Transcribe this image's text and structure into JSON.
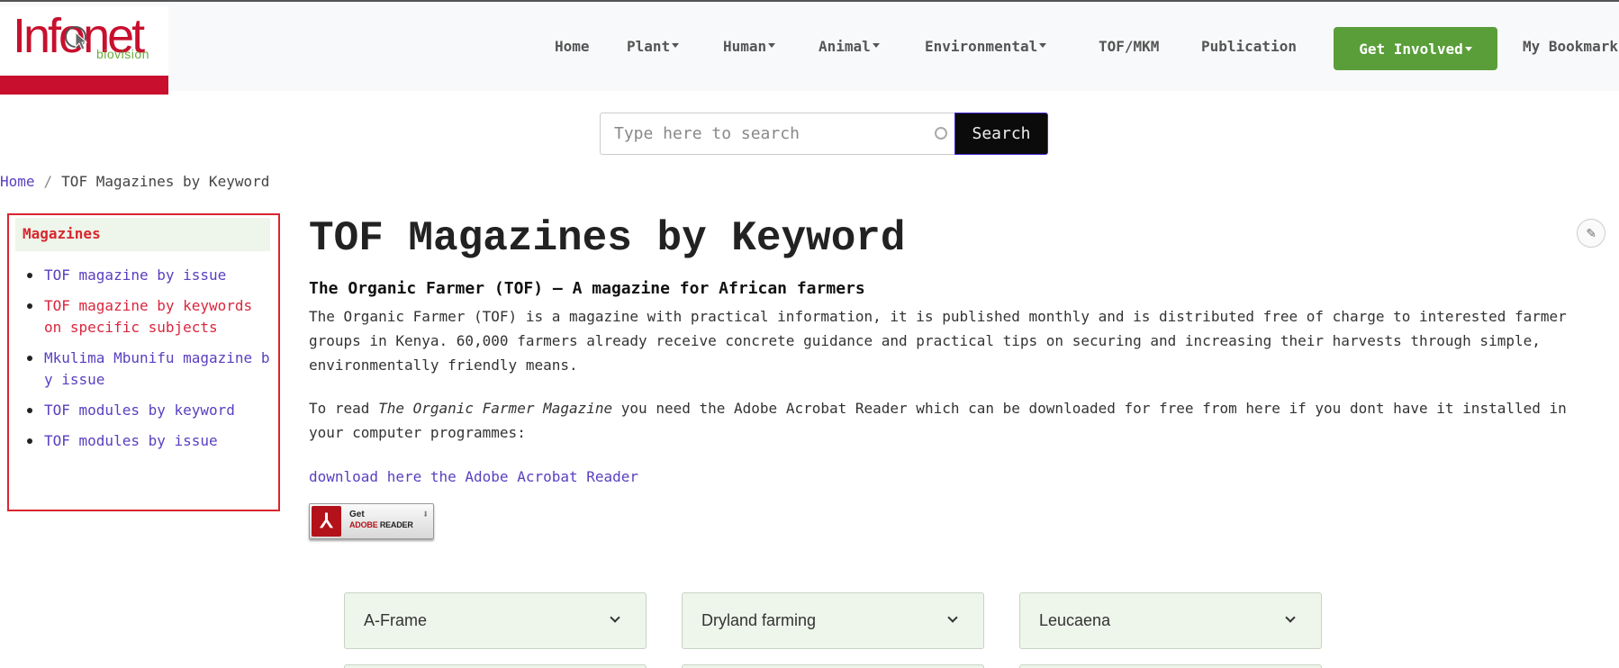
{
  "brand": {
    "name": "Infonet",
    "sub": "biovision"
  },
  "nav": {
    "home": "Home",
    "plant": "Plant",
    "human": "Human",
    "animal": "Animal",
    "environmental": "Environmental",
    "tof_mkm": "TOF/MKM",
    "publication": "Publication",
    "get_involved": "Get Involved",
    "bookmarks": "My Bookmarks"
  },
  "search": {
    "placeholder": "Type here to search",
    "button": "Search"
  },
  "breadcrumb": {
    "home": "Home",
    "sep": "/",
    "current": "TOF Magazines by Keyword"
  },
  "sidebar": {
    "title": "Magazines",
    "items": [
      {
        "label": "TOF magazine by issue"
      },
      {
        "label": "TOF magazine by keywords on specific subjects"
      },
      {
        "label": "Mkulima Mbunifu magazine by issue"
      },
      {
        "label": "TOF modules by keyword"
      },
      {
        "label": "TOF modules by issue"
      }
    ]
  },
  "main": {
    "title": "TOF Magazines by Keyword",
    "subtitle": "The Organic Farmer (TOF) – A magazine for African farmers",
    "intro": "The Organic Farmer (TOF) is a magazine with practical information, it is published monthly and is distributed free of charge to interested farmer groups in Kenya. 60,000 farmers already receive concrete guidance and practical tips on securing and increasing their harvests through simple, environmentally friendly means.",
    "read_prefix": "To read ",
    "read_title": "The Organic Farmer Magazine",
    "read_suffix": " you need the Adobe Acrobat Reader which can be downloaded for free from here if you dont have it installed in your computer programmes:",
    "download_link": "download here the Adobe Acrobat Reader",
    "adobe_badge": {
      "get": "Get",
      "brand": "ADOBE",
      "product": " READER"
    }
  },
  "keywords": [
    {
      "label": "A-Frame"
    },
    {
      "label": "Dryland farming"
    },
    {
      "label": "Leucaena"
    }
  ],
  "colors": {
    "brand_red": "#c8102e",
    "brand_green": "#5a9e3a",
    "link_purple": "#5a3fc0",
    "keyword_bg": "#eef5ea"
  }
}
